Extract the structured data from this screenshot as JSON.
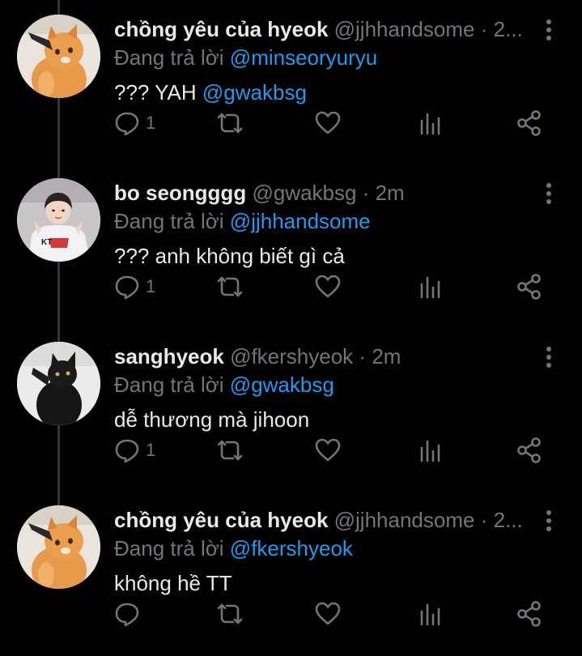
{
  "colors": {
    "background": "#000000",
    "text": "#e7e9ea",
    "secondary": "#71767b",
    "link": "#1d9bf0",
    "thread_line": "#333639"
  },
  "reply_prefix": "Đang trả lời",
  "tweets": [
    {
      "display_name": "chồng yêu của hyeok",
      "handle": "@jjhhandsome",
      "dot": "·",
      "time": "2...",
      "replying_to": "@minseoryuryu",
      "text_plain": "??? YAH ",
      "text_mention": "@gwakbsg",
      "reply_count": "1",
      "avatar_icon": "orange-cat-avatar"
    },
    {
      "display_name": "bo seongggg",
      "handle": "@gwakbsg",
      "dot": "·",
      "time": "2m",
      "replying_to": "@jjhhandsome",
      "text_plain": "??? anh không biết gì cả",
      "text_mention": "",
      "reply_count": "1",
      "avatar_icon": "person-avatar"
    },
    {
      "display_name": "sanghyeok",
      "handle": "@fkershyeok",
      "dot": "·",
      "time": "2m",
      "replying_to": "@gwakbsg",
      "text_plain": "dễ thương mà jihoon",
      "text_mention": "",
      "reply_count": "1",
      "avatar_icon": "black-cat-avatar"
    },
    {
      "display_name": "chồng yêu của hyeok",
      "handle": "@jjhhandsome",
      "dot": "·",
      "time": "2...",
      "replying_to": "@fkershyeok",
      "text_plain": "không hề TT",
      "text_mention": "",
      "reply_count": "",
      "avatar_icon": "orange-cat-avatar"
    }
  ]
}
